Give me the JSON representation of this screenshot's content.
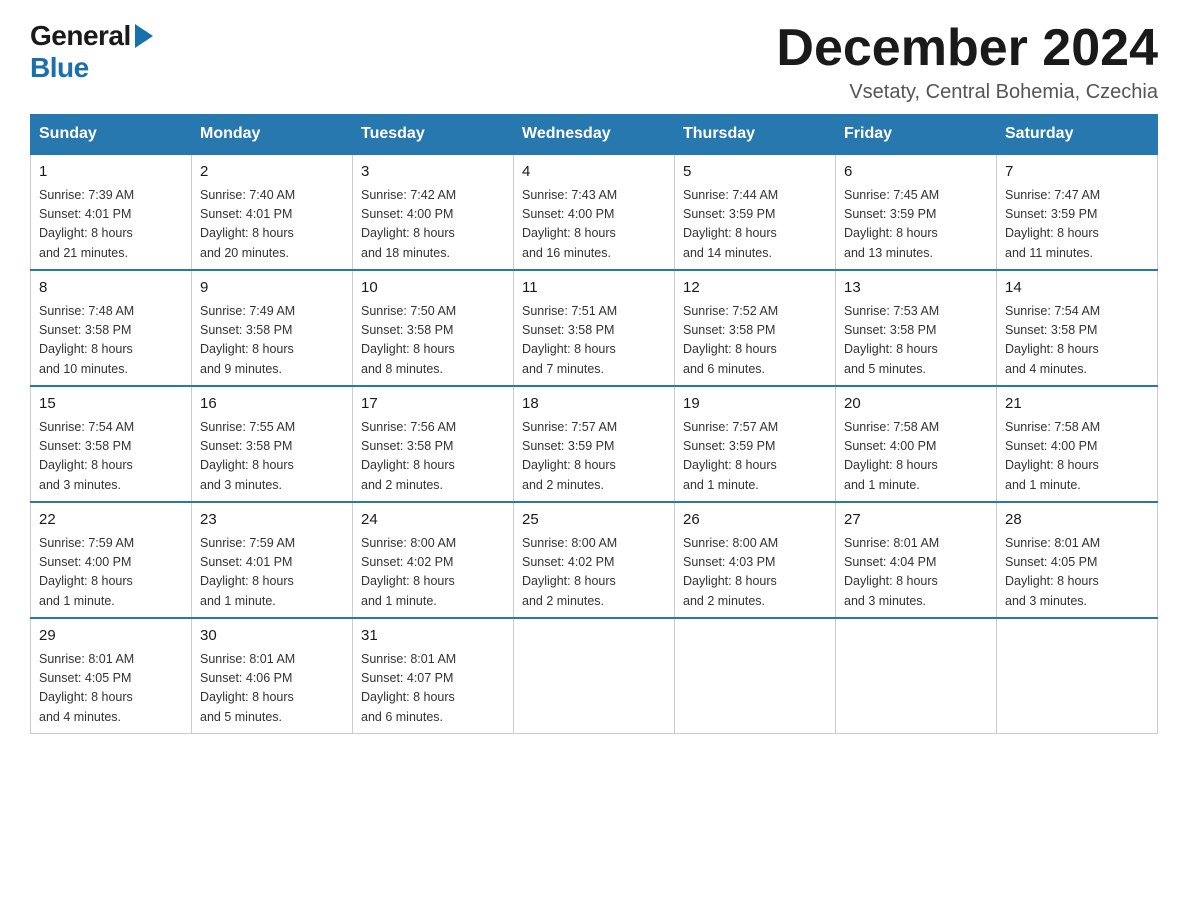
{
  "logo": {
    "general": "General",
    "blue": "Blue"
  },
  "title": "December 2024",
  "subtitle": "Vsetaty, Central Bohemia, Czechia",
  "headers": [
    "Sunday",
    "Monday",
    "Tuesday",
    "Wednesday",
    "Thursday",
    "Friday",
    "Saturday"
  ],
  "weeks": [
    [
      {
        "day": "1",
        "sunrise": "7:39 AM",
        "sunset": "4:01 PM",
        "daylight": "8 hours and 21 minutes."
      },
      {
        "day": "2",
        "sunrise": "7:40 AM",
        "sunset": "4:01 PM",
        "daylight": "8 hours and 20 minutes."
      },
      {
        "day": "3",
        "sunrise": "7:42 AM",
        "sunset": "4:00 PM",
        "daylight": "8 hours and 18 minutes."
      },
      {
        "day": "4",
        "sunrise": "7:43 AM",
        "sunset": "4:00 PM",
        "daylight": "8 hours and 16 minutes."
      },
      {
        "day": "5",
        "sunrise": "7:44 AM",
        "sunset": "3:59 PM",
        "daylight": "8 hours and 14 minutes."
      },
      {
        "day": "6",
        "sunrise": "7:45 AM",
        "sunset": "3:59 PM",
        "daylight": "8 hours and 13 minutes."
      },
      {
        "day": "7",
        "sunrise": "7:47 AM",
        "sunset": "3:59 PM",
        "daylight": "8 hours and 11 minutes."
      }
    ],
    [
      {
        "day": "8",
        "sunrise": "7:48 AM",
        "sunset": "3:58 PM",
        "daylight": "8 hours and 10 minutes."
      },
      {
        "day": "9",
        "sunrise": "7:49 AM",
        "sunset": "3:58 PM",
        "daylight": "8 hours and 9 minutes."
      },
      {
        "day": "10",
        "sunrise": "7:50 AM",
        "sunset": "3:58 PM",
        "daylight": "8 hours and 8 minutes."
      },
      {
        "day": "11",
        "sunrise": "7:51 AM",
        "sunset": "3:58 PM",
        "daylight": "8 hours and 7 minutes."
      },
      {
        "day": "12",
        "sunrise": "7:52 AM",
        "sunset": "3:58 PM",
        "daylight": "8 hours and 6 minutes."
      },
      {
        "day": "13",
        "sunrise": "7:53 AM",
        "sunset": "3:58 PM",
        "daylight": "8 hours and 5 minutes."
      },
      {
        "day": "14",
        "sunrise": "7:54 AM",
        "sunset": "3:58 PM",
        "daylight": "8 hours and 4 minutes."
      }
    ],
    [
      {
        "day": "15",
        "sunrise": "7:54 AM",
        "sunset": "3:58 PM",
        "daylight": "8 hours and 3 minutes."
      },
      {
        "day": "16",
        "sunrise": "7:55 AM",
        "sunset": "3:58 PM",
        "daylight": "8 hours and 3 minutes."
      },
      {
        "day": "17",
        "sunrise": "7:56 AM",
        "sunset": "3:58 PM",
        "daylight": "8 hours and 2 minutes."
      },
      {
        "day": "18",
        "sunrise": "7:57 AM",
        "sunset": "3:59 PM",
        "daylight": "8 hours and 2 minutes."
      },
      {
        "day": "19",
        "sunrise": "7:57 AM",
        "sunset": "3:59 PM",
        "daylight": "8 hours and 1 minute."
      },
      {
        "day": "20",
        "sunrise": "7:58 AM",
        "sunset": "4:00 PM",
        "daylight": "8 hours and 1 minute."
      },
      {
        "day": "21",
        "sunrise": "7:58 AM",
        "sunset": "4:00 PM",
        "daylight": "8 hours and 1 minute."
      }
    ],
    [
      {
        "day": "22",
        "sunrise": "7:59 AM",
        "sunset": "4:00 PM",
        "daylight": "8 hours and 1 minute."
      },
      {
        "day": "23",
        "sunrise": "7:59 AM",
        "sunset": "4:01 PM",
        "daylight": "8 hours and 1 minute."
      },
      {
        "day": "24",
        "sunrise": "8:00 AM",
        "sunset": "4:02 PM",
        "daylight": "8 hours and 1 minute."
      },
      {
        "day": "25",
        "sunrise": "8:00 AM",
        "sunset": "4:02 PM",
        "daylight": "8 hours and 2 minutes."
      },
      {
        "day": "26",
        "sunrise": "8:00 AM",
        "sunset": "4:03 PM",
        "daylight": "8 hours and 2 minutes."
      },
      {
        "day": "27",
        "sunrise": "8:01 AM",
        "sunset": "4:04 PM",
        "daylight": "8 hours and 3 minutes."
      },
      {
        "day": "28",
        "sunrise": "8:01 AM",
        "sunset": "4:05 PM",
        "daylight": "8 hours and 3 minutes."
      }
    ],
    [
      {
        "day": "29",
        "sunrise": "8:01 AM",
        "sunset": "4:05 PM",
        "daylight": "8 hours and 4 minutes."
      },
      {
        "day": "30",
        "sunrise": "8:01 AM",
        "sunset": "4:06 PM",
        "daylight": "8 hours and 5 minutes."
      },
      {
        "day": "31",
        "sunrise": "8:01 AM",
        "sunset": "4:07 PM",
        "daylight": "8 hours and 6 minutes."
      },
      null,
      null,
      null,
      null
    ]
  ],
  "labels": {
    "sunrise": "Sunrise:",
    "sunset": "Sunset:",
    "daylight": "Daylight:"
  }
}
